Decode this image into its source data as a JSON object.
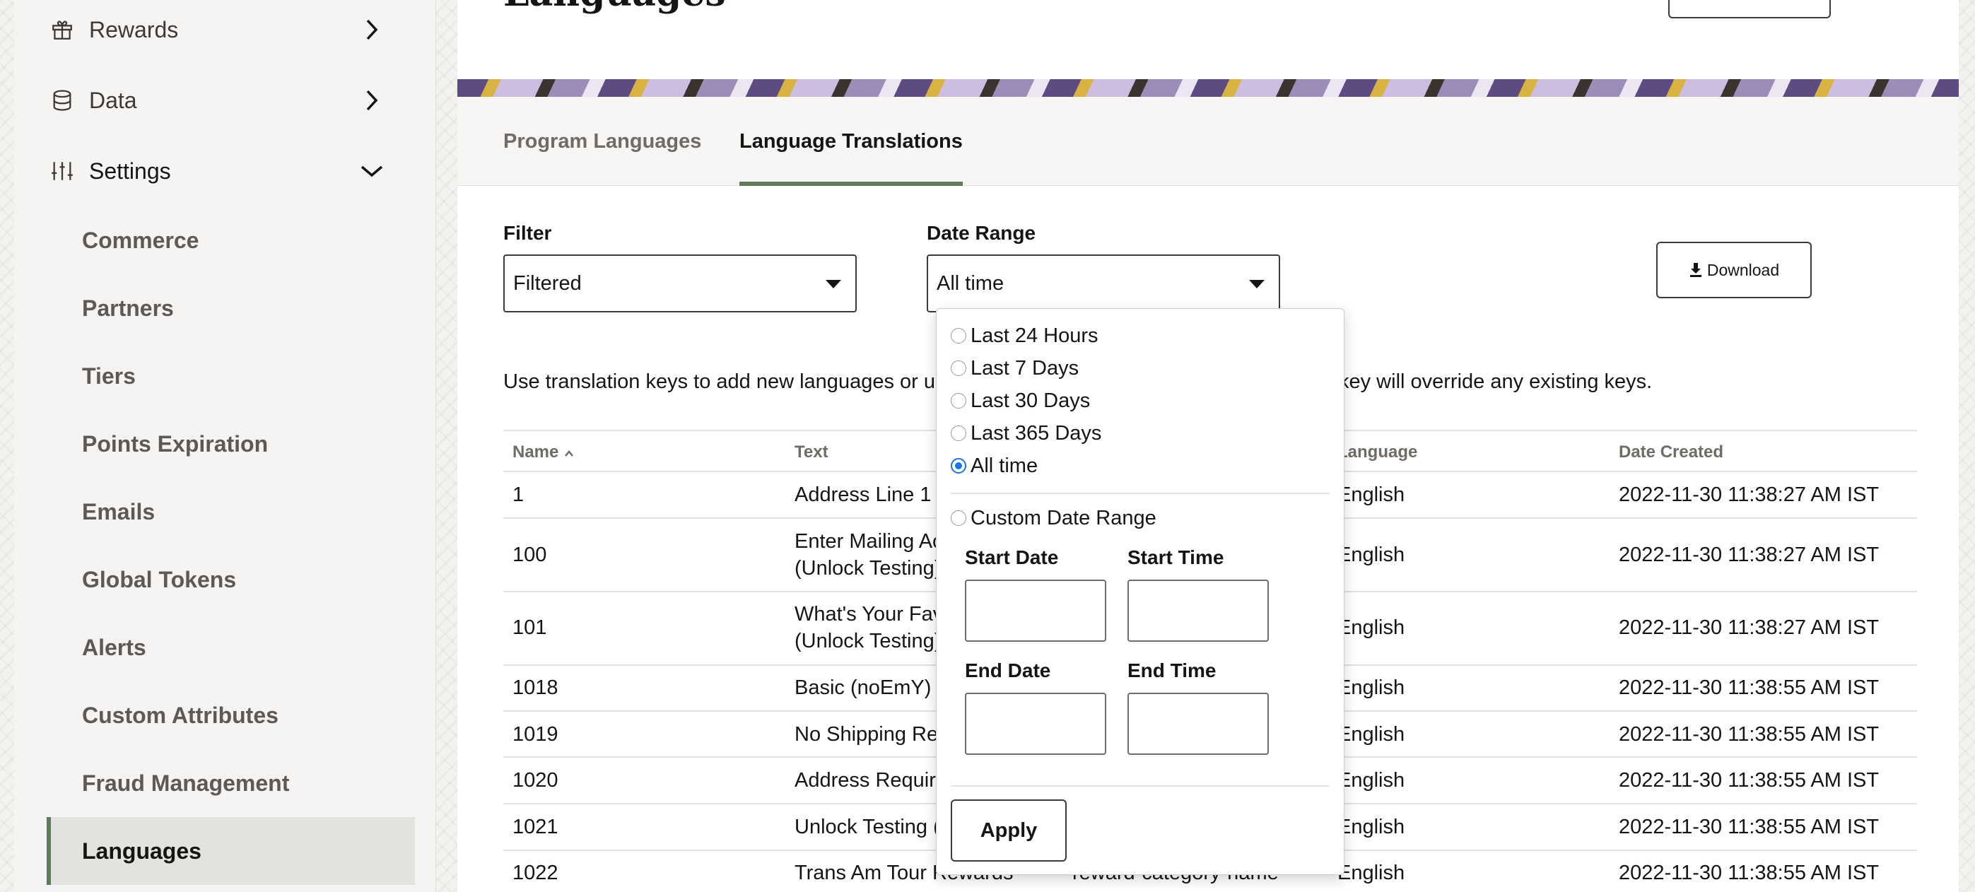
{
  "sidebar": {
    "top_items": [
      {
        "label": "Rewards",
        "icon": "gift-icon",
        "chevron": "chevron-right-icon"
      },
      {
        "label": "Data",
        "icon": "database-icon",
        "chevron": "chevron-right-icon"
      },
      {
        "label": "Settings",
        "icon": "sliders-icon",
        "chevron": "chevron-down-icon"
      }
    ],
    "settings_items": [
      {
        "label": "Commerce"
      },
      {
        "label": "Partners"
      },
      {
        "label": "Tiers"
      },
      {
        "label": "Points Expiration"
      },
      {
        "label": "Emails"
      },
      {
        "label": "Global Tokens"
      },
      {
        "label": "Alerts"
      },
      {
        "label": "Custom Attributes"
      },
      {
        "label": "Fraud Management"
      },
      {
        "label": "Languages",
        "active": true
      }
    ]
  },
  "page": {
    "title": "Languages"
  },
  "tabs": [
    {
      "label": "Program Languages"
    },
    {
      "label": "Language Translations",
      "active": true
    }
  ],
  "filters": {
    "filter_label": "Filter",
    "filter_value": "Filtered",
    "date_range_label": "Date Range",
    "date_range_value": "All time",
    "download_label": "Download"
  },
  "help_text": {
    "left": "Use translation keys to add new languages or upo",
    "right": "key will override any existing keys."
  },
  "table": {
    "headers": {
      "name": "Name",
      "text": "Text",
      "language": "Language",
      "date_created": "Date Created"
    },
    "rows": [
      {
        "name": "1",
        "text": [
          "Address Line 1"
        ],
        "language": "English",
        "date": "2022-11-30 11:38:27 AM IST"
      },
      {
        "name": "100",
        "text": [
          "Enter Mailing Ac",
          "(Unlock Testing)"
        ],
        "language": "English",
        "date": "2022-11-30 11:38:27 AM IST"
      },
      {
        "name": "101",
        "text": [
          "What's Your Fav",
          "(Unlock Testing)"
        ],
        "language": "English",
        "date": "2022-11-30 11:38:27 AM IST"
      },
      {
        "name": "1018",
        "text": [
          "Basic (noEmY)"
        ],
        "language": "English",
        "date": "2022-11-30 11:38:55 AM IST"
      },
      {
        "name": "1019",
        "text": [
          "No Shipping Re"
        ],
        "language": "English",
        "date": "2022-11-30 11:38:55 AM IST"
      },
      {
        "name": "1020",
        "text": [
          "Address Require"
        ],
        "language": "English",
        "date": "2022-11-30 11:38:55 AM IST"
      },
      {
        "name": "1021",
        "text": [
          "Unlock Testing ("
        ],
        "language": "English",
        "date": "2022-11-30 11:38:55 AM IST"
      },
      {
        "name": "1022",
        "text": [
          "Trans Am Tour Rewards"
        ],
        "key_fragment": "reward-category-name",
        "language": "English",
        "date": "2022-11-30 11:38:55 AM IST"
      }
    ]
  },
  "date_popover": {
    "options": [
      "Last 24 Hours",
      "Last 7 Days",
      "Last 30 Days",
      "Last 365 Days",
      "All time"
    ],
    "selected": "All time",
    "custom_label": "Custom Date Range",
    "start_date_label": "Start Date",
    "start_time_label": "Start Time",
    "end_date_label": "End Date",
    "end_time_label": "End Time",
    "apply_label": "Apply"
  },
  "colors": {
    "accent_green": "#5f7a5b",
    "radio_blue": "#1a73e8"
  }
}
